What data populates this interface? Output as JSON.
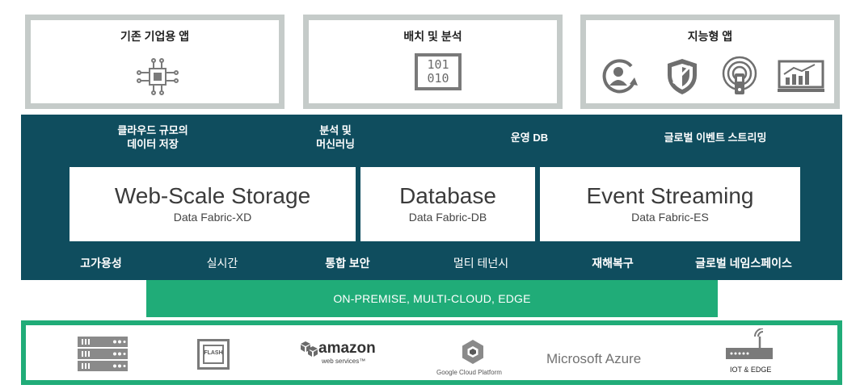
{
  "apps": [
    {
      "title": "기존 기업용 앱",
      "icon": "circuit-chip-icon"
    },
    {
      "title": "배치 및 분석",
      "icon": "binary-data-icon",
      "binary_lines": [
        "101",
        "010"
      ]
    },
    {
      "title": "지능형 앱",
      "icons": [
        "user-refresh-icon",
        "shield-icon",
        "wireless-device-icon",
        "analytics-screen-icon"
      ]
    }
  ],
  "capabilities": [
    "클라우드 규모의",
    "데이터 저장",
    "분석 및",
    "머신러닝",
    "운영 DB",
    "글로벌 이벤트 스트리밍"
  ],
  "storage": [
    {
      "name": "Web-Scale Storage",
      "product": "Data Fabric-XD"
    },
    {
      "name": "Database",
      "product": "Data Fabric-DB"
    },
    {
      "name": "Event Streaming",
      "product": "Data Fabric-ES"
    }
  ],
  "features": [
    "고가용성",
    "실시간",
    "통합 보안",
    "멀티 테넌시",
    "재해복구",
    "글로벌 네임스페이스"
  ],
  "deployment": "ON-PREMISE, MULTI-CLOUD, EDGE",
  "infrastructure": {
    "server": "server-rack-icon",
    "flash_label": "FLASH",
    "amazon_main": "amazon",
    "amazon_sub": "web services™",
    "gcp_label": "Google Cloud Platform",
    "azure": "Microsoft Azure",
    "iot_label": "IOT & EDGE"
  },
  "colors": {
    "teal": "#0f4d5e",
    "green": "#20ac78",
    "gray_border": "#c5cbc9",
    "icon_gray": "#7a7a7a"
  }
}
